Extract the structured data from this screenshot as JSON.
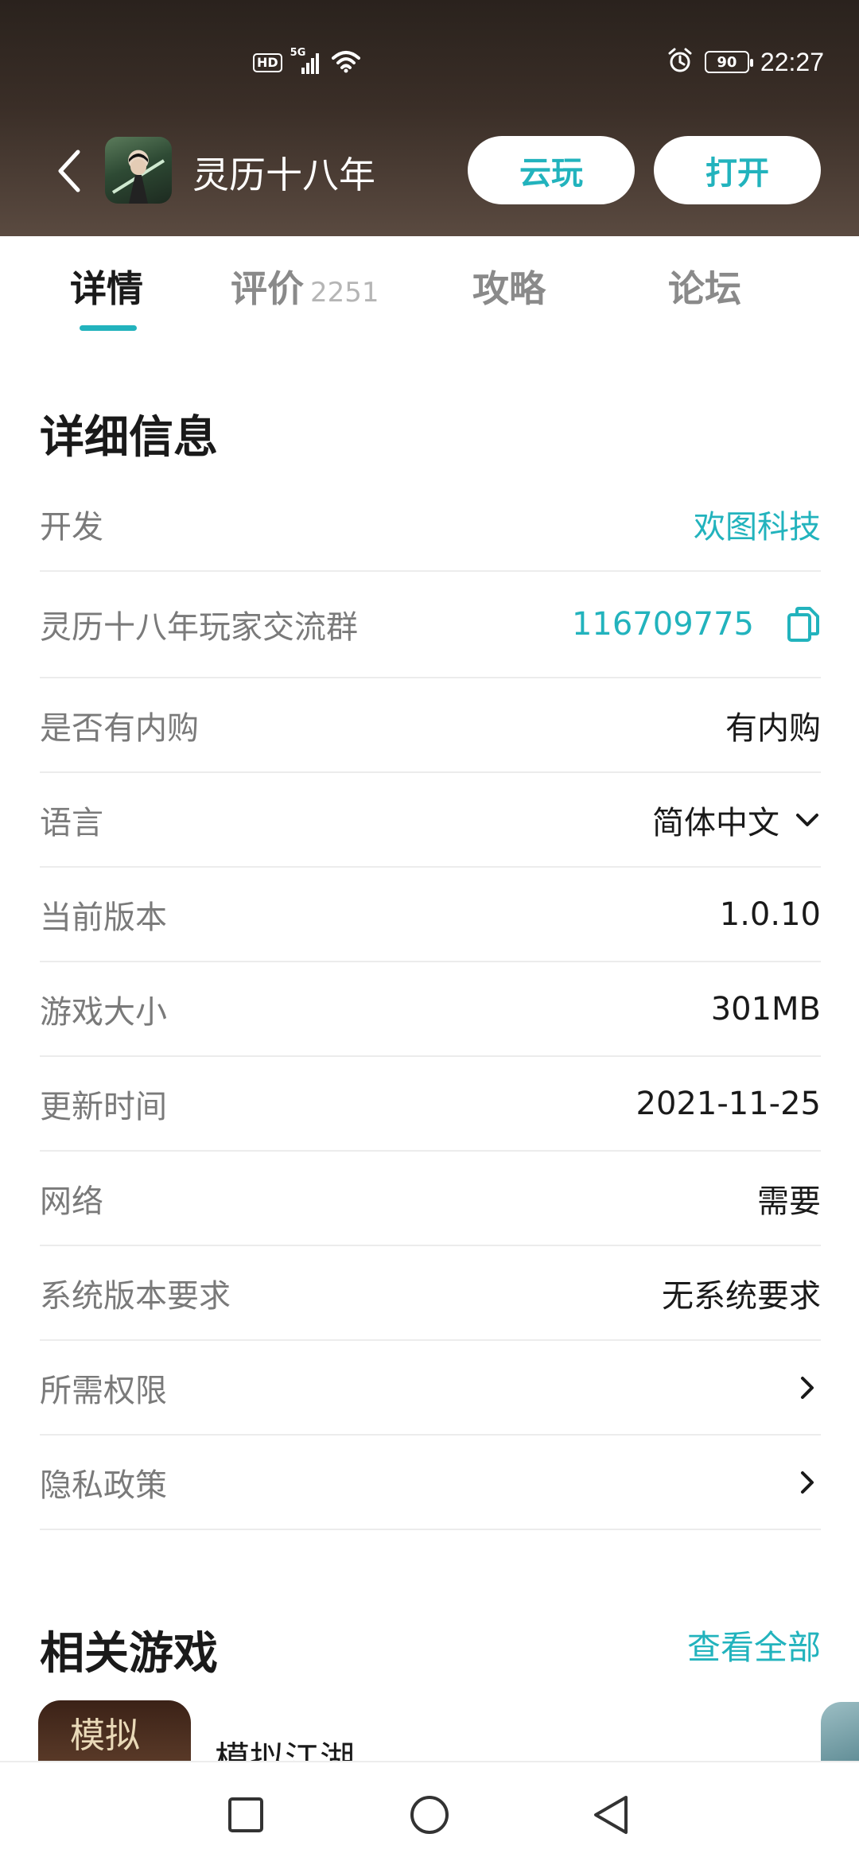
{
  "status_bar": {
    "network_hd": "HD",
    "network_type": "5G",
    "battery": "90",
    "time": "22:27"
  },
  "header": {
    "app_name": "灵历十八年",
    "cloud_play_label": "云玩",
    "open_label": "打开"
  },
  "tabs": [
    {
      "label": "详情",
      "active": true
    },
    {
      "label": "评价",
      "count": "2251"
    },
    {
      "label": "攻略"
    },
    {
      "label": "论坛"
    }
  ],
  "details": {
    "title": "详细信息",
    "rows": [
      {
        "label": "开发",
        "value": "欢图科技"
      },
      {
        "label": "灵历十八年玩家交流群",
        "value": "116709775"
      },
      {
        "label": "是否有内购",
        "value": "有内购"
      },
      {
        "label": "语言",
        "value": "简体中文"
      },
      {
        "label": "当前版本",
        "value": "1.0.10"
      },
      {
        "label": "游戏大小",
        "value": "301MB"
      },
      {
        "label": "更新时间",
        "value": "2021-11-25"
      },
      {
        "label": "网络",
        "value": "需要"
      },
      {
        "label": "系统版本要求",
        "value": "无系统要求"
      },
      {
        "label": "所需权限",
        "value": ""
      },
      {
        "label": "隐私政策",
        "value": ""
      }
    ]
  },
  "related": {
    "title": "相关游戏",
    "see_all": "查看全部",
    "games": [
      {
        "name": "模拟江湖",
        "thumb_text": "模拟"
      }
    ]
  },
  "colors": {
    "accent": "#22b3bd",
    "header_bg": "#3a2e27"
  }
}
